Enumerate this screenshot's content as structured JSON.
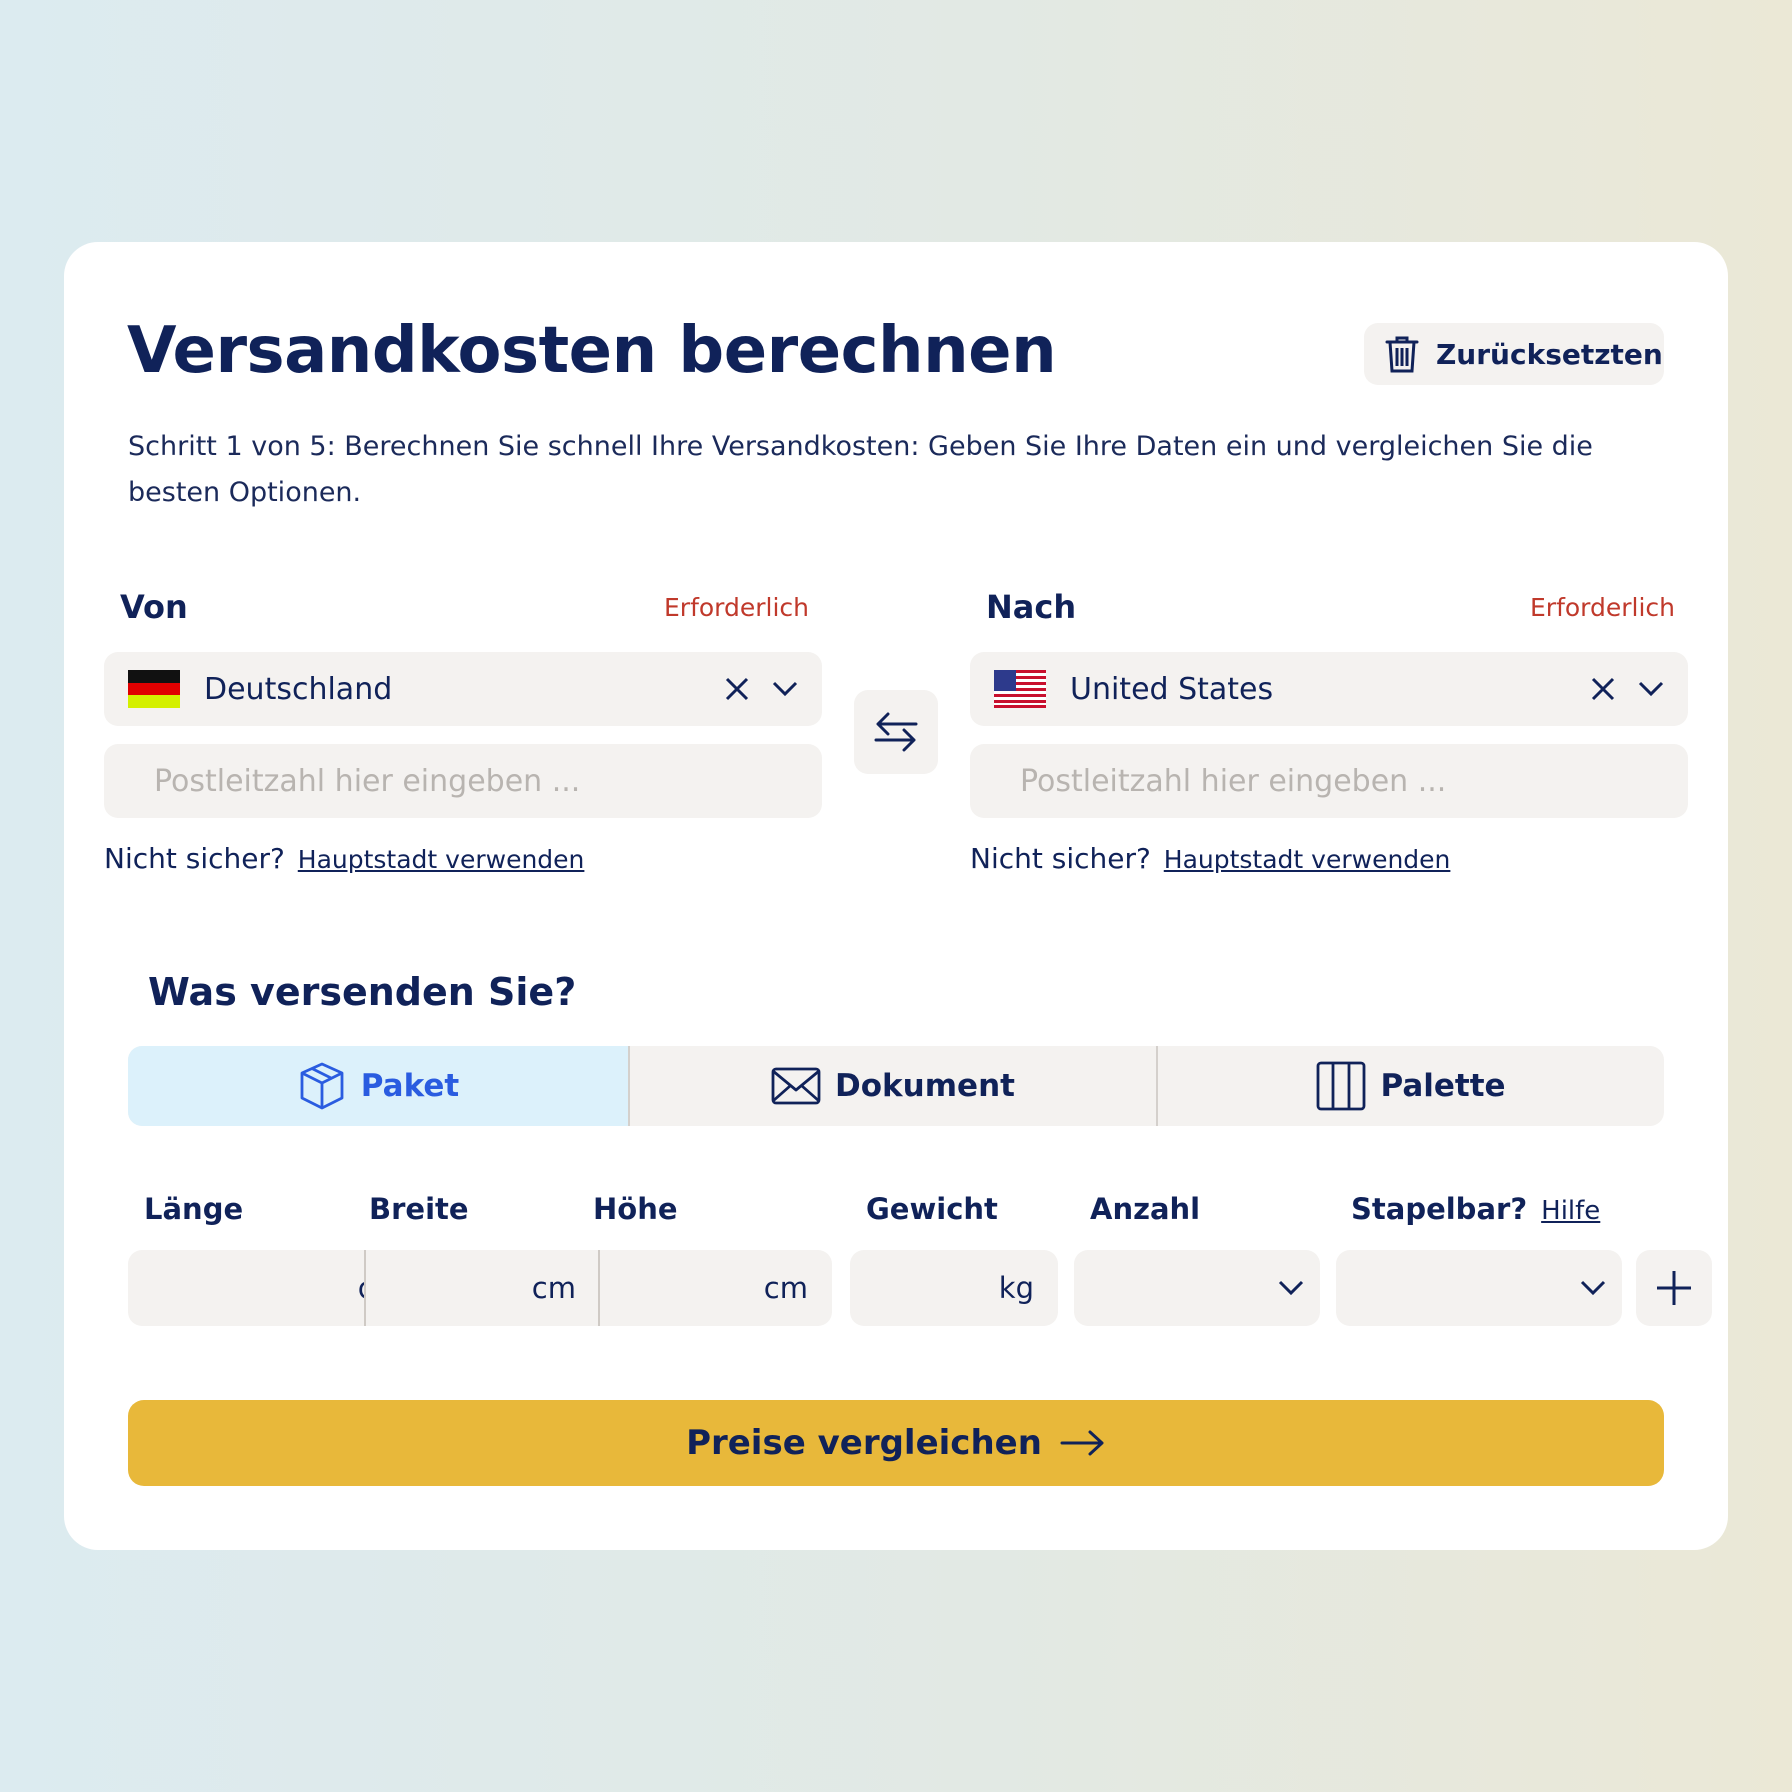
{
  "header": {
    "title": "Versandkosten berechnen",
    "reset_label": "Zurücksetzten",
    "description": "Schritt 1 von 5: Berechnen Sie schnell Ihre Versandkosten: Geben Sie Ihre Daten ein und vergleichen Sie die besten Optionen."
  },
  "from": {
    "label": "Von",
    "required": "Erforderlich",
    "country": "Deutschland",
    "flag": "germany-flag",
    "zip_placeholder": "Postleitzahl hier eingeben ...",
    "hint": "Nicht sicher?",
    "hint_link": "Hauptstadt verwenden"
  },
  "to": {
    "label": "Nach",
    "required": "Erforderlich",
    "country": "United States",
    "flag": "us-flag",
    "zip_placeholder": "Postleitzahl hier eingeben ...",
    "hint": "Nicht sicher?",
    "hint_link": "Hauptstadt verwenden"
  },
  "shipment": {
    "title": "Was versenden Sie?",
    "tabs": [
      {
        "label": "Paket",
        "icon": "box-icon",
        "active": true
      },
      {
        "label": "Dokument",
        "icon": "envelope-icon",
        "active": false
      },
      {
        "label": "Palette",
        "icon": "pallet-icon",
        "active": false
      }
    ],
    "fields": {
      "length": {
        "label": "Länge",
        "unit": "cm"
      },
      "width": {
        "label": "Breite",
        "unit": "cm"
      },
      "height": {
        "label": "Höhe",
        "unit": "cm"
      },
      "weight": {
        "label": "Gewicht",
        "unit": "kg"
      },
      "count": {
        "label": "Anzahl"
      },
      "stackable": {
        "label": "Stapelbar?",
        "help": "Hilfe"
      }
    }
  },
  "cta": {
    "label": "Preise vergleichen"
  },
  "colors": {
    "primary": "#102259",
    "accent": "#e8b83a",
    "required": "#c0392b",
    "active_tab_bg": "#dcf1fb",
    "active_tab_text": "#2a5ce0"
  }
}
